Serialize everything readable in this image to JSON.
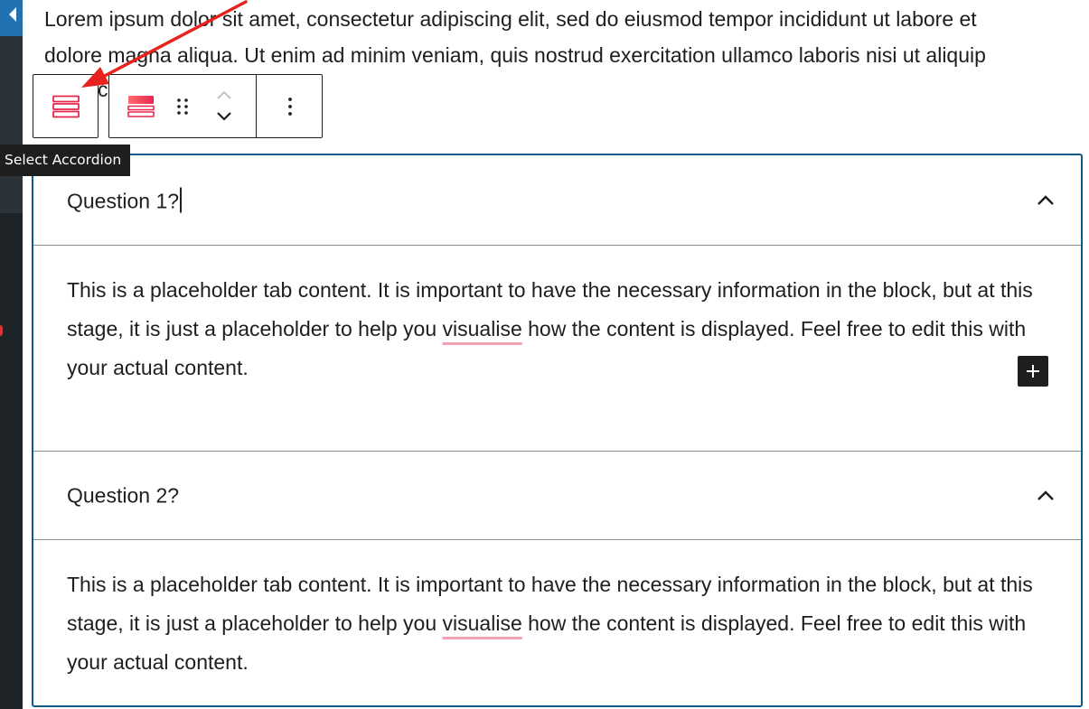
{
  "intro_paragraph": {
    "line_1": "Lorem ipsum dolor sit amet, consectetur adipiscing elit, sed do eiusmod tempor incididunt ut labore et",
    "line_2": "dolore magna aliqua. Ut enim ad minim veniam, quis nostrud exercitation ullamco laboris nisi ut aliquip",
    "line_3_fragment": "c"
  },
  "toolbar": {
    "parent_icon": "accordion-list-icon",
    "block_icon": "accordion-block-icon",
    "drag_icon": "drag-handle-icon",
    "move_up_icon": "chevron-up-icon",
    "move_down_icon": "chevron-down-icon",
    "options_icon": "more-vertical-icon"
  },
  "tooltip": {
    "text": "Select Accordion"
  },
  "accordion": {
    "items": [
      {
        "title": "Question 1?",
        "body_before": "This is a placeholder tab content. It is important to have the necessary information in the block, but at this stage, it is just a placeholder to help you ",
        "body_misspelled": "visualise",
        "body_after": " how the content is displayed. Feel free to edit this with your actual content.",
        "toggle_icon": "chevron-up-icon"
      },
      {
        "title": "Question 2?",
        "body_before": "This is a placeholder tab content. It is important to have the necessary information in the block, but at this stage, it is just a placeholder to help you ",
        "body_misspelled": "visualise",
        "body_after": " how the content is displayed. Feel free to edit this with your actual content.",
        "toggle_icon": "chevron-up-icon"
      }
    ],
    "inserter_icon": "plus-icon"
  },
  "colors": {
    "accent_pink": "#e8264e",
    "accordion_border": "#0e5a8a",
    "annotation_arrow": "#e8231f",
    "admin_bar": "#1d2327",
    "admin_active": "#2271b1"
  }
}
